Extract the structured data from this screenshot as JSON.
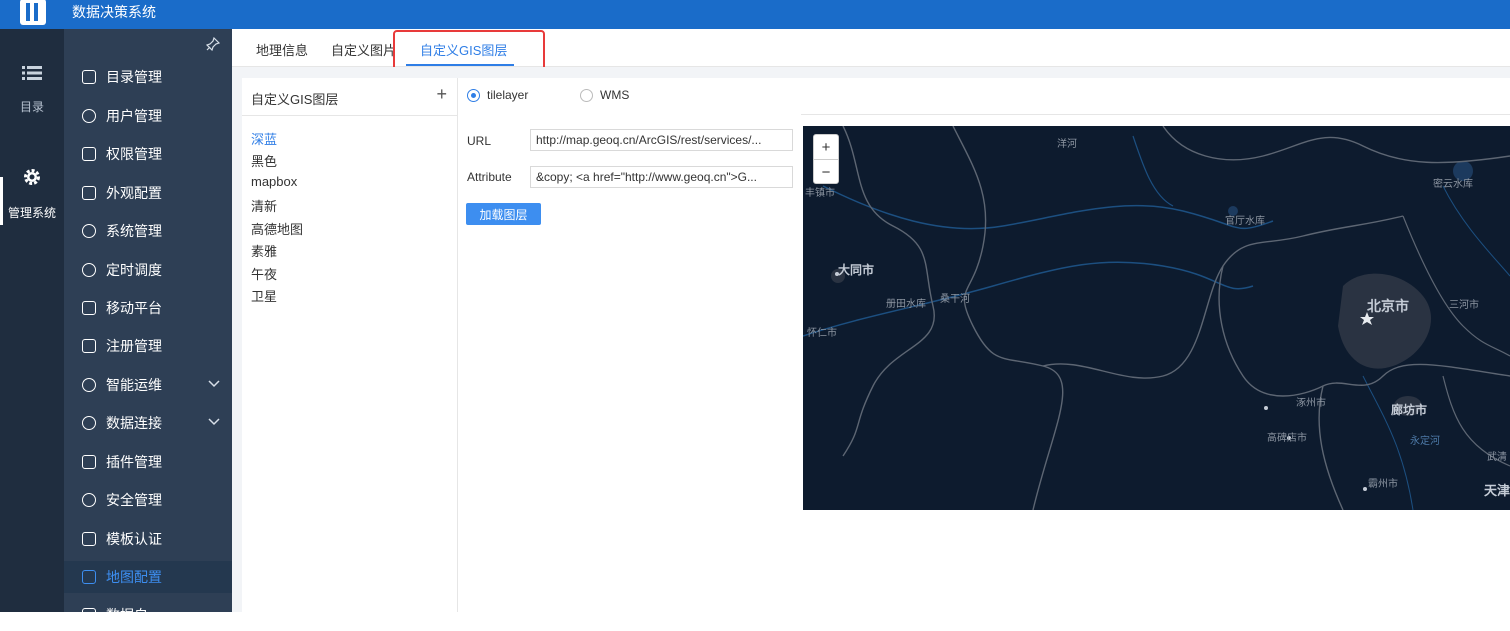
{
  "app": {
    "title": "数据决策系统"
  },
  "rail": {
    "items": [
      {
        "label": "目录",
        "icon": "list-icon"
      },
      {
        "label": "管理系统",
        "icon": "gear-icon"
      }
    ]
  },
  "menu": {
    "items": [
      {
        "label": "目录管理",
        "icon": "catalog-icon"
      },
      {
        "label": "用户管理",
        "icon": "user-icon"
      },
      {
        "label": "权限管理",
        "icon": "lock-icon"
      },
      {
        "label": "外观配置",
        "icon": "brush-icon"
      },
      {
        "label": "系统管理",
        "icon": "settings-icon"
      },
      {
        "label": "定时调度",
        "icon": "timer-icon"
      },
      {
        "label": "移动平台",
        "icon": "mobile-icon"
      },
      {
        "label": "注册管理",
        "icon": "register-icon"
      },
      {
        "label": "智能运维",
        "icon": "ops-icon",
        "expandable": true
      },
      {
        "label": "数据连接",
        "icon": "link-icon",
        "expandable": true
      },
      {
        "label": "插件管理",
        "icon": "plugin-icon"
      },
      {
        "label": "安全管理",
        "icon": "shield-icon"
      },
      {
        "label": "模板认证",
        "icon": "template-icon"
      },
      {
        "label": "地图配置",
        "icon": "map-icon",
        "active": true
      },
      {
        "label": "数据自",
        "icon": "data-icon"
      }
    ]
  },
  "tabs": [
    {
      "label": "地理信息"
    },
    {
      "label": "自定义图片"
    },
    {
      "label": "自定义GIS图层",
      "active": true
    }
  ],
  "layer_list": {
    "title": "自定义GIS图层",
    "add_symbol": "+",
    "items": [
      "深蓝",
      "黑色",
      "mapbox",
      "清新",
      "高德地图",
      "素雅",
      "午夜",
      "卫星"
    ],
    "selected": "深蓝"
  },
  "config": {
    "types": [
      {
        "label": "tilelayer",
        "checked": true
      },
      {
        "label": "WMS",
        "checked": false
      }
    ],
    "url_label": "URL",
    "url_value": "http://map.geoq.cn/ArcGIS/rest/services/...",
    "attr_label": "Attribute",
    "attr_value": "&copy; <a href=\"http://www.geoq.cn\">G...",
    "load_button": "加载图层"
  },
  "map": {
    "zoom_in": "+",
    "zoom_out": "−",
    "labels": {
      "yanghe": "洋河",
      "miyun": "密云水库",
      "fengzhen": "丰镇市",
      "guanting": "官厅水库",
      "datong": "大同市",
      "cetian": "册田水库",
      "sangganhe": "桑干河",
      "beijing": "北京市",
      "sanhe": "三河市",
      "huairen": "怀仁市",
      "zhuozhou": "涿州市",
      "langfang": "廊坊市",
      "gaobeidian": "高碑店市",
      "yongdinghe": "永定河",
      "bazhou": "霸州市",
      "tianjin": "天津",
      "wuqing": "武清"
    },
    "colors": {
      "background": "#0d1b2e",
      "land": "#111f33",
      "border": "#5d6673",
      "water": "#1c4f80"
    }
  },
  "colors": {
    "accent": "#2f7ee6",
    "topbar": "#1a6cc9",
    "menu_bg": "#2e3f55",
    "rail_bg": "#1f2d3f",
    "highlight": "#e83a3a"
  }
}
